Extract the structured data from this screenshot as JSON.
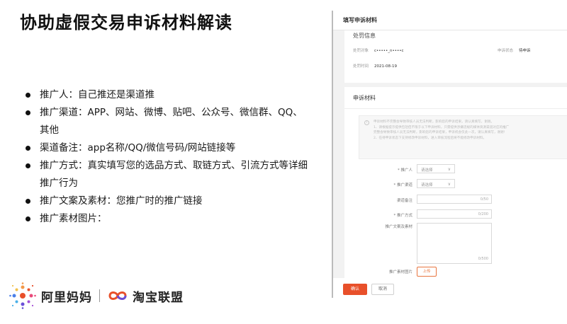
{
  "slide": {
    "title": "协助虚假交易申诉材料解读",
    "bullets": [
      "推广人：自己推还是渠道推",
      "推广渠道：APP、网站、微博、贴吧、公众号、微信群、QQ、其他",
      "渠道备注：app名称/QQ/微信号码/网站链接等",
      "推广方式：真实填写您的选品方式、取链方式、引流方式等详细推广行为",
      "推广文案及素材：您推广时的推广链接",
      "推广素材图片："
    ]
  },
  "brand": {
    "name": "阿里妈妈",
    "name2": "淘宝联盟",
    "accent": "#e8502a"
  },
  "screenshot": {
    "header": "填写申诉材料",
    "section1": {
      "title": "处罚信息",
      "target_label": "处罚对象",
      "target_value": "c•••••_n••••c",
      "status_label": "申诉状态",
      "status_value": "待申诉",
      "date_label": "处罚时间",
      "date_value": "2021-08-19"
    },
    "section2": {
      "title": "申诉材料",
      "notice_icon": "info-icon",
      "notice_lines": [
        "申诉材料不完整会导致审核人员无法判断，影响您的申诉结果，请认真填写，谢谢。",
        "1、请根据提示提供包括但不限于以下申诉材料，只需提供涉嫌违规的媒体资源渠道对应的推广",
        "完整会导致审核人员无法判断，影响您的申诉结果，申诉机会仅此一次，请认真填写，谢谢!",
        "2、在待申诉状态下支持修改申诉材料，进入审核流程后将不能修改申诉材料。"
      ],
      "fields": {
        "promoter_label": "* 推广人",
        "promoter_placeholder": "请选择",
        "channel_label": "* 推广渠道",
        "channel_placeholder": "请选择",
        "channel_note_label": "渠道备注",
        "channel_note_count": "0/50",
        "method_label": "* 推广方式",
        "method_count": "0/200",
        "copy_label": "推广文案及素材",
        "copy_count": "0/500",
        "image_label": "推广素材图片",
        "upload_label": "上传"
      }
    },
    "footer": {
      "confirm_label": "确认",
      "cancel_label": "取消"
    }
  }
}
